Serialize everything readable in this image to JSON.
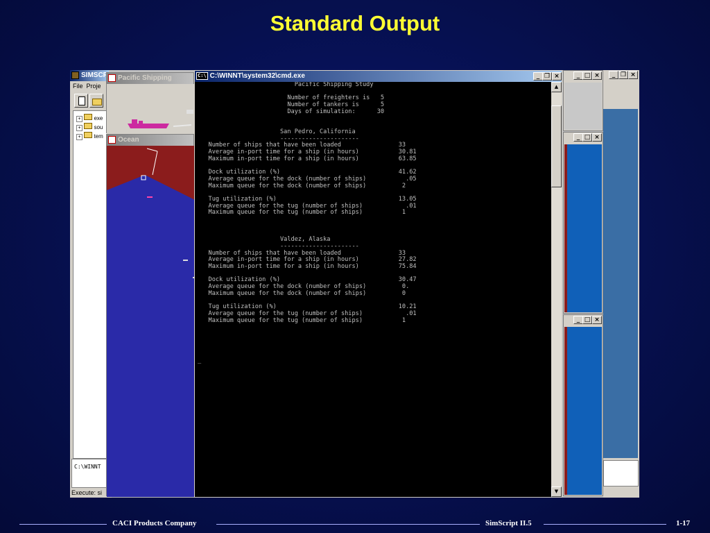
{
  "slide": {
    "title": "Standard Output",
    "footer_left": "CACI Products Company",
    "footer_center": "SimScript II.5",
    "footer_right": "1-17"
  },
  "simscript_window": {
    "title": "SIMSCR",
    "menu": [
      "File",
      "Proje"
    ],
    "tree_items": [
      "exe",
      "sou",
      "tem"
    ],
    "console_prompt": "C:\\WINNT",
    "status_text": "Execute: si"
  },
  "pacific_shipping_window": {
    "title": "Pacific Shipping"
  },
  "ocean_window": {
    "title": "Ocean"
  },
  "cmd_window": {
    "title": "C:\\WINNT\\system32\\cmd.exe",
    "icon_text": "C:\\",
    "output_lines": [
      "                           Pacific Shipping Study",
      "",
      "                         Number of freighters is   5",
      "                         Number of tankers is      5",
      "                         Days of simulation:      30",
      "",
      "",
      "                       San Pedro, California",
      "                       ----------------------",
      "   Number of ships that have been loaded                33",
      "   Average in-port time for a ship (in hours)           30.81",
      "   Maximum in-port time for a ship (in hours)           63.85",
      "",
      "   Dock utilization (%)                                 41.62",
      "   Average queue for the dock (number of ships)           .05",
      "   Maximum queue for the dock (number of ships)          2",
      "",
      "   Tug utilization (%)                                  13.05",
      "   Average queue for the tug (number of ships)            .01",
      "   Maximum queue for the tug (number of ships)           1",
      "",
      "",
      "",
      "                       Valdez, Alaska",
      "                       ----------------------",
      "   Number of ships that have been loaded                33",
      "   Average in-port time for a ship (in hours)           27.82",
      "   Maximum in-port time for a ship (in hours)           75.84",
      "",
      "   Dock utilization (%)                                 30.47",
      "   Average queue for the dock (number of ships)          0.",
      "   Maximum queue for the dock (number of ships)          0",
      "",
      "   Tug utilization (%)                                  10.21",
      "   Average queue for the tug (number of ships)            .01",
      "   Maximum queue for the tug (number of ships)           1",
      "",
      "",
      "",
      "",
      "",
      "_"
    ]
  },
  "colors": {
    "background": "#06104f",
    "title": "#ffff33",
    "ocean_red": "#8b1c1c",
    "ocean_blue": "#2a2aa8",
    "right_blue": "#1060b8",
    "ship_magenta": "#cc2aa0"
  }
}
